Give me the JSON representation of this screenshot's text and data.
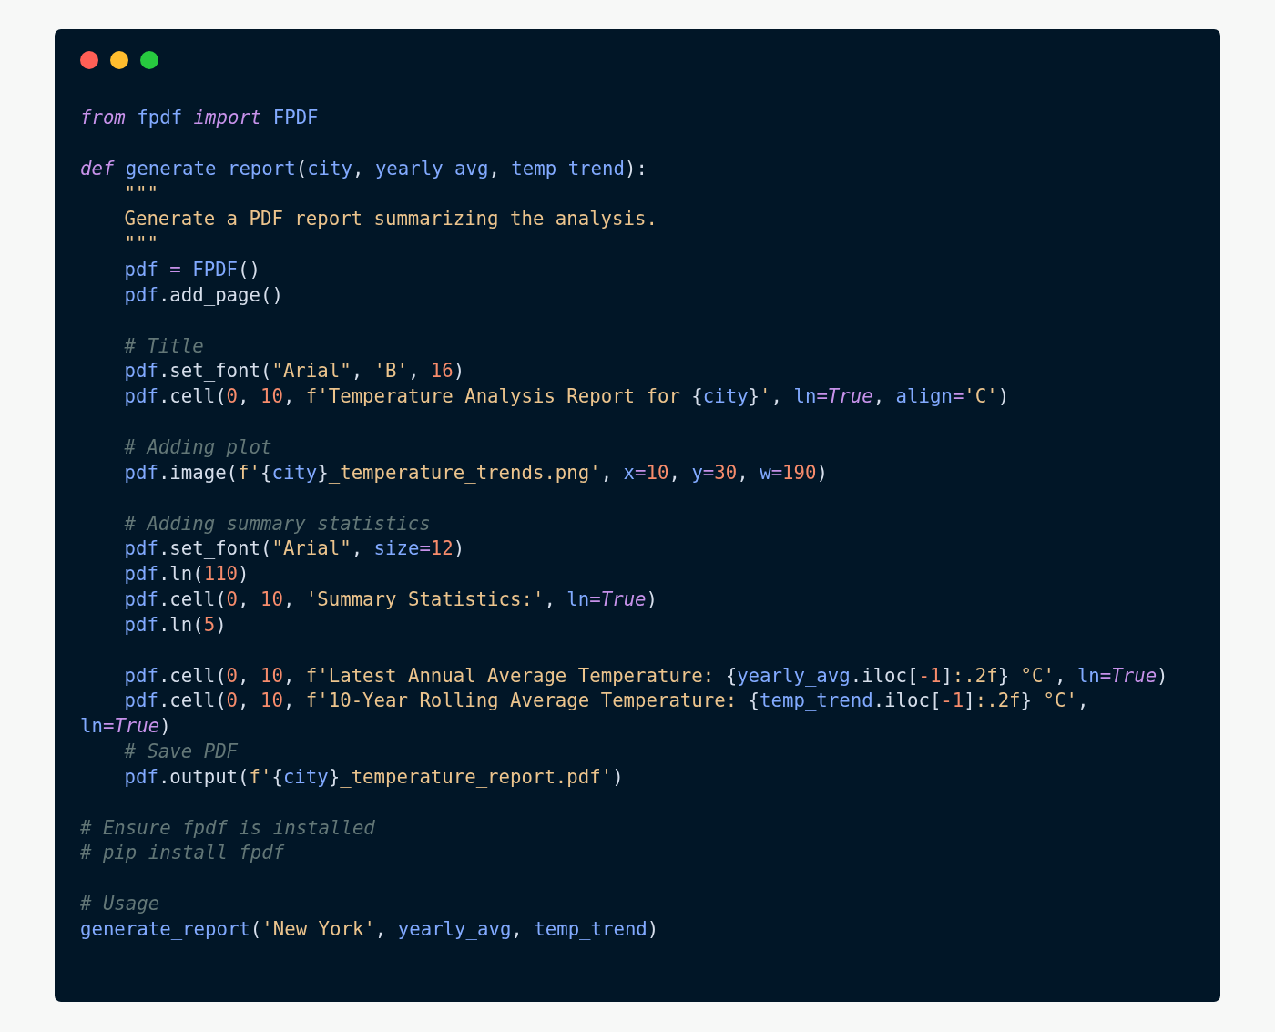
{
  "window_controls": [
    {
      "color": "#ff5f56"
    },
    {
      "color": "#ffbd2e"
    },
    {
      "color": "#27c93f"
    }
  ],
  "code_lines": [
    {
      "blank_line_before": false,
      "indented": false,
      "tokens": [
        {
          "kind": "kw",
          "text": "from"
        },
        {
          "kind": "name",
          "text": " fpdf "
        },
        {
          "kind": "kw",
          "text": "import"
        },
        {
          "kind": "name",
          "text": " FPDF"
        }
      ]
    },
    {
      "blank_line_before": true,
      "indented": false,
      "tokens": [
        {
          "kind": "kw",
          "text": "def"
        },
        {
          "kind": "name",
          "text": " generate_report"
        },
        {
          "kind": "plain",
          "text": "("
        },
        {
          "kind": "name",
          "text": "city"
        },
        {
          "kind": "plain",
          "text": ", "
        },
        {
          "kind": "name",
          "text": "yearly_avg"
        },
        {
          "kind": "plain",
          "text": ", "
        },
        {
          "kind": "name",
          "text": "temp_trend"
        },
        {
          "kind": "plain",
          "text": "):"
        }
      ]
    },
    {
      "blank_line_before": false,
      "indented": true,
      "tokens": [
        {
          "kind": "str",
          "text": "\"\"\""
        }
      ]
    },
    {
      "blank_line_before": false,
      "indented": true,
      "tokens": [
        {
          "kind": "str",
          "text": "Generate a PDF report summarizing the analysis."
        }
      ]
    },
    {
      "blank_line_before": false,
      "indented": true,
      "tokens": [
        {
          "kind": "str",
          "text": "\"\"\""
        }
      ]
    },
    {
      "blank_line_before": false,
      "indented": true,
      "tokens": [
        {
          "kind": "name",
          "text": "pdf"
        },
        {
          "kind": "op",
          "text": " = "
        },
        {
          "kind": "name",
          "text": "FPDF"
        },
        {
          "kind": "plain",
          "text": "()"
        }
      ]
    },
    {
      "blank_line_before": false,
      "indented": true,
      "tokens": [
        {
          "kind": "name",
          "text": "pdf"
        },
        {
          "kind": "plain",
          "text": ".add_page()"
        }
      ]
    },
    {
      "blank_line_before": true,
      "indented": true,
      "tokens": [
        {
          "kind": "com",
          "text": "# Title"
        }
      ]
    },
    {
      "blank_line_before": false,
      "indented": true,
      "tokens": [
        {
          "kind": "name",
          "text": "pdf"
        },
        {
          "kind": "plain",
          "text": ".set_font("
        },
        {
          "kind": "str",
          "text": "\"Arial\""
        },
        {
          "kind": "plain",
          "text": ", "
        },
        {
          "kind": "str",
          "text": "'B'"
        },
        {
          "kind": "plain",
          "text": ", "
        },
        {
          "kind": "num",
          "text": "16"
        },
        {
          "kind": "plain",
          "text": ")"
        }
      ]
    },
    {
      "blank_line_before": false,
      "indented": true,
      "tokens": [
        {
          "kind": "name",
          "text": "pdf"
        },
        {
          "kind": "plain",
          "text": ".cell("
        },
        {
          "kind": "num",
          "text": "0"
        },
        {
          "kind": "plain",
          "text": ", "
        },
        {
          "kind": "num",
          "text": "10"
        },
        {
          "kind": "plain",
          "text": ", "
        },
        {
          "kind": "str",
          "text": "f'Temperature Analysis Report for "
        },
        {
          "kind": "plain",
          "text": "{"
        },
        {
          "kind": "name",
          "text": "city"
        },
        {
          "kind": "plain",
          "text": "}"
        },
        {
          "kind": "str",
          "text": "'"
        },
        {
          "kind": "plain",
          "text": ", "
        },
        {
          "kind": "name",
          "text": "ln"
        },
        {
          "kind": "op",
          "text": "="
        },
        {
          "kind": "bool",
          "text": "True"
        },
        {
          "kind": "plain",
          "text": ", "
        },
        {
          "kind": "name",
          "text": "align"
        },
        {
          "kind": "op",
          "text": "="
        },
        {
          "kind": "str",
          "text": "'C'"
        },
        {
          "kind": "plain",
          "text": ")"
        }
      ]
    },
    {
      "blank_line_before": true,
      "indented": true,
      "tokens": [
        {
          "kind": "com",
          "text": "# Adding plot"
        }
      ]
    },
    {
      "blank_line_before": false,
      "indented": true,
      "tokens": [
        {
          "kind": "name",
          "text": "pdf"
        },
        {
          "kind": "plain",
          "text": ".image("
        },
        {
          "kind": "str",
          "text": "f'"
        },
        {
          "kind": "plain",
          "text": "{"
        },
        {
          "kind": "name",
          "text": "city"
        },
        {
          "kind": "plain",
          "text": "}"
        },
        {
          "kind": "str",
          "text": "_temperature_trends.png'"
        },
        {
          "kind": "plain",
          "text": ", "
        },
        {
          "kind": "name",
          "text": "x"
        },
        {
          "kind": "op",
          "text": "="
        },
        {
          "kind": "num",
          "text": "10"
        },
        {
          "kind": "plain",
          "text": ", "
        },
        {
          "kind": "name",
          "text": "y"
        },
        {
          "kind": "op",
          "text": "="
        },
        {
          "kind": "num",
          "text": "30"
        },
        {
          "kind": "plain",
          "text": ", "
        },
        {
          "kind": "name",
          "text": "w"
        },
        {
          "kind": "op",
          "text": "="
        },
        {
          "kind": "num",
          "text": "190"
        },
        {
          "kind": "plain",
          "text": ")"
        }
      ]
    },
    {
      "blank_line_before": true,
      "indented": true,
      "tokens": [
        {
          "kind": "com",
          "text": "# Adding summary statistics"
        }
      ]
    },
    {
      "blank_line_before": false,
      "indented": true,
      "tokens": [
        {
          "kind": "name",
          "text": "pdf"
        },
        {
          "kind": "plain",
          "text": ".set_font("
        },
        {
          "kind": "str",
          "text": "\"Arial\""
        },
        {
          "kind": "plain",
          "text": ", "
        },
        {
          "kind": "name",
          "text": "size"
        },
        {
          "kind": "op",
          "text": "="
        },
        {
          "kind": "num",
          "text": "12"
        },
        {
          "kind": "plain",
          "text": ")"
        }
      ]
    },
    {
      "blank_line_before": false,
      "indented": true,
      "tokens": [
        {
          "kind": "name",
          "text": "pdf"
        },
        {
          "kind": "plain",
          "text": ".ln("
        },
        {
          "kind": "num",
          "text": "110"
        },
        {
          "kind": "plain",
          "text": ")"
        }
      ]
    },
    {
      "blank_line_before": false,
      "indented": true,
      "tokens": [
        {
          "kind": "name",
          "text": "pdf"
        },
        {
          "kind": "plain",
          "text": ".cell("
        },
        {
          "kind": "num",
          "text": "0"
        },
        {
          "kind": "plain",
          "text": ", "
        },
        {
          "kind": "num",
          "text": "10"
        },
        {
          "kind": "plain",
          "text": ", "
        },
        {
          "kind": "str",
          "text": "'Summary Statistics:'"
        },
        {
          "kind": "plain",
          "text": ", "
        },
        {
          "kind": "name",
          "text": "ln"
        },
        {
          "kind": "op",
          "text": "="
        },
        {
          "kind": "bool",
          "text": "True"
        },
        {
          "kind": "plain",
          "text": ")"
        }
      ]
    },
    {
      "blank_line_before": false,
      "indented": true,
      "tokens": [
        {
          "kind": "name",
          "text": "pdf"
        },
        {
          "kind": "plain",
          "text": ".ln("
        },
        {
          "kind": "num",
          "text": "5"
        },
        {
          "kind": "plain",
          "text": ")"
        }
      ]
    },
    {
      "blank_line_before": true,
      "indented": true,
      "tokens": [
        {
          "kind": "name",
          "text": "pdf"
        },
        {
          "kind": "plain",
          "text": ".cell("
        },
        {
          "kind": "num",
          "text": "0"
        },
        {
          "kind": "plain",
          "text": ", "
        },
        {
          "kind": "num",
          "text": "10"
        },
        {
          "kind": "plain",
          "text": ", "
        },
        {
          "kind": "str",
          "text": "f'Latest Annual Average Temperature: "
        },
        {
          "kind": "plain",
          "text": "{"
        },
        {
          "kind": "name",
          "text": "yearly_avg"
        },
        {
          "kind": "plain",
          "text": ".iloc["
        },
        {
          "kind": "num",
          "text": "-1"
        },
        {
          "kind": "plain",
          "text": "]"
        },
        {
          "kind": "str",
          "text": ":.2f"
        },
        {
          "kind": "plain",
          "text": "}"
        },
        {
          "kind": "str",
          "text": " °C'"
        },
        {
          "kind": "plain",
          "text": ", "
        },
        {
          "kind": "name",
          "text": "ln"
        },
        {
          "kind": "op",
          "text": "="
        },
        {
          "kind": "bool",
          "text": "True"
        },
        {
          "kind": "plain",
          "text": ")"
        }
      ]
    },
    {
      "blank_line_before": false,
      "indented": true,
      "tokens": [
        {
          "kind": "name",
          "text": "pdf"
        },
        {
          "kind": "plain",
          "text": ".cell("
        },
        {
          "kind": "num",
          "text": "0"
        },
        {
          "kind": "plain",
          "text": ", "
        },
        {
          "kind": "num",
          "text": "10"
        },
        {
          "kind": "plain",
          "text": ", "
        },
        {
          "kind": "str",
          "text": "f'10-Year Rolling Average Temperature: "
        },
        {
          "kind": "plain",
          "text": "{"
        },
        {
          "kind": "name",
          "text": "temp_trend"
        },
        {
          "kind": "plain",
          "text": ".iloc["
        },
        {
          "kind": "num",
          "text": "-1"
        },
        {
          "kind": "plain",
          "text": "]"
        },
        {
          "kind": "str",
          "text": ":.2f"
        },
        {
          "kind": "plain",
          "text": "}"
        },
        {
          "kind": "str",
          "text": " °C'"
        },
        {
          "kind": "plain",
          "text": ","
        }
      ]
    },
    {
      "blank_line_before": false,
      "indented": false,
      "tokens": [
        {
          "kind": "name",
          "text": "ln"
        },
        {
          "kind": "op",
          "text": "="
        },
        {
          "kind": "bool",
          "text": "True"
        },
        {
          "kind": "plain",
          "text": ")"
        }
      ]
    },
    {
      "blank_line_before": false,
      "indented": true,
      "tokens": [
        {
          "kind": "com",
          "text": "# Save PDF"
        }
      ]
    },
    {
      "blank_line_before": false,
      "indented": true,
      "tokens": [
        {
          "kind": "name",
          "text": "pdf"
        },
        {
          "kind": "plain",
          "text": ".output("
        },
        {
          "kind": "str",
          "text": "f'"
        },
        {
          "kind": "plain",
          "text": "{"
        },
        {
          "kind": "name",
          "text": "city"
        },
        {
          "kind": "plain",
          "text": "}"
        },
        {
          "kind": "str",
          "text": "_temperature_report.pdf'"
        },
        {
          "kind": "plain",
          "text": ")"
        }
      ]
    },
    {
      "blank_line_before": true,
      "indented": false,
      "tokens": [
        {
          "kind": "com",
          "text": "# Ensure fpdf is installed"
        }
      ]
    },
    {
      "blank_line_before": false,
      "indented": false,
      "tokens": [
        {
          "kind": "com",
          "text": "# pip install fpdf"
        }
      ]
    },
    {
      "blank_line_before": true,
      "indented": false,
      "tokens": [
        {
          "kind": "com",
          "text": "# Usage"
        }
      ]
    },
    {
      "blank_line_before": false,
      "indented": false,
      "tokens": [
        {
          "kind": "name",
          "text": "generate_report"
        },
        {
          "kind": "plain",
          "text": "("
        },
        {
          "kind": "str",
          "text": "'New York'"
        },
        {
          "kind": "plain",
          "text": ", "
        },
        {
          "kind": "name",
          "text": "yearly_avg"
        },
        {
          "kind": "plain",
          "text": ", "
        },
        {
          "kind": "name",
          "text": "temp_trend"
        },
        {
          "kind": "plain",
          "text": ")"
        }
      ]
    }
  ]
}
